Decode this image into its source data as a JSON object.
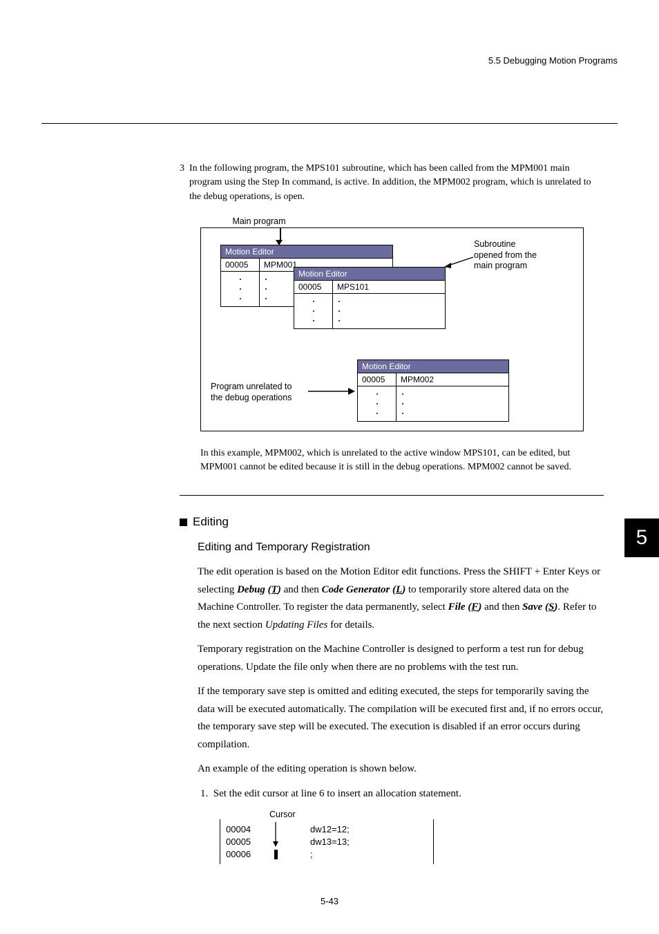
{
  "header": {
    "breadcrumb": "5.5  Debugging Motion Programs"
  },
  "step3": {
    "num": "3",
    "text": "In the following program, the MPS101 subroutine, which has been called from the MPM001 main program using the Step In command, is active. In addition, the MPM002 program, which is unrelated to the debug operations, is open."
  },
  "diagram1": {
    "main_label": "Main program",
    "sub_annot_l1": "Subroutine",
    "sub_annot_l2": "opened from the",
    "sub_annot_l3": "main program",
    "unrelated_l1": "Program unrelated to",
    "unrelated_l2": "the debug operations",
    "win_title": "Motion Editor",
    "num": "00005",
    "p1": "MPM001",
    "p2": "MPS101",
    "p3": "MPM002"
  },
  "note": {
    "l1": "In this example, MPM002, which is unrelated to the active window MPS101, can be edited, but",
    "l2": "MPM001 cannot be edited because it is still in the debug operations. MPM002 cannot be saved."
  },
  "headings": {
    "editing": "Editing",
    "sub": "Editing and Temporary Registration"
  },
  "para1": {
    "t1": "The edit operation is based on the Motion Editor edit functions. Press the SHIFT + Enter Keys or selecting ",
    "debug": "Debug (",
    "debugU": "T",
    "debug2": ")",
    "t2": " and then ",
    "cg": "Code Generator (",
    "cgU": "L",
    "cg2": ")",
    "t3": " to temporarily store altered data on the Machine Controller. To register the data permanently, select ",
    "file": "File (",
    "fileU": "F",
    "file2": ")",
    "t4": " and then ",
    "save": "Save (",
    "saveU": "S",
    "save2": ")",
    "t5": ". Refer to the next section ",
    "updating": "Updating Files",
    "t6": " for details."
  },
  "para2": "Temporary registration on the Machine Controller is designed to perform a test run for debug operations. Update the file only when there are no problems with the test run.",
  "para3": "If the temporary save step is omitted and editing executed, the steps for temporarily saving the data will be executed automatically. The compilation will be executed first and, if no errors occur, the temporary save step will be executed. The execution is disabled if an error occurs during compilation.",
  "para4": "An example of the editing operation is shown below.",
  "step1": {
    "num": "1.",
    "text": "Set the edit cursor at line 6 to insert an allocation statement."
  },
  "diagram2": {
    "cursor": "Cursor",
    "rows": [
      {
        "ln": "00004",
        "code": "dw12=12;"
      },
      {
        "ln": "00005",
        "code": "dw13=13;"
      },
      {
        "ln": "00006",
        "code": ";"
      }
    ]
  },
  "sidetab": "5",
  "footer": "5-43"
}
